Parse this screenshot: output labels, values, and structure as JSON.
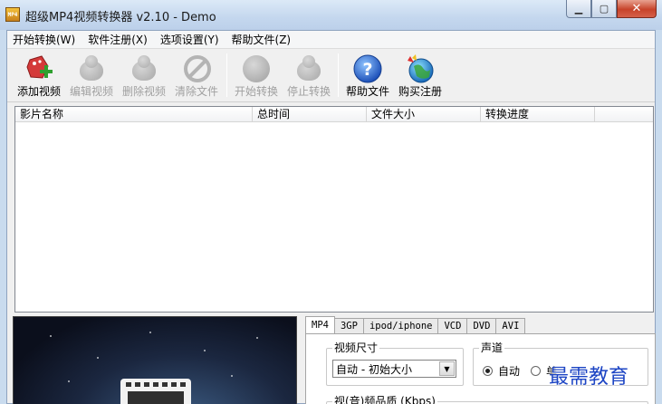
{
  "window": {
    "title": "超级MP4视频转换器 v2.10 - Demo",
    "app_icon_text": "MP4",
    "minimize_glyph": "▁",
    "maximize_glyph": "▢",
    "close_glyph": "✕"
  },
  "menu": {
    "items": [
      "开始转换(W)",
      "软件注册(X)",
      "选项设置(Y)",
      "帮助文件(Z)"
    ]
  },
  "toolbar": {
    "buttons": [
      {
        "label": "添加视频",
        "icon": "add-video-icon",
        "enabled": true
      },
      {
        "label": "编辑视频",
        "icon": "edit-video-icon",
        "enabled": false
      },
      {
        "label": "删除视频",
        "icon": "delete-video-icon",
        "enabled": false
      },
      {
        "label": "清除文件",
        "icon": "clear-files-icon",
        "enabled": false
      },
      {
        "label": "开始转换",
        "icon": "start-convert-icon",
        "enabled": false
      },
      {
        "label": "停止转换",
        "icon": "stop-convert-icon",
        "enabled": false
      },
      {
        "label": "帮助文件",
        "icon": "help-icon",
        "enabled": true
      },
      {
        "label": "购买注册",
        "icon": "buy-register-icon",
        "enabled": true
      }
    ]
  },
  "file_list": {
    "columns": [
      "影片名称",
      "总时间",
      "文件大小",
      "转换进度"
    ],
    "rows": []
  },
  "format_tabs": {
    "tabs": [
      "MP4",
      "3GP",
      "ipod/iphone",
      "VCD",
      "DVD",
      "AVI"
    ],
    "active": "MP4"
  },
  "settings": {
    "video_size_label": "视频尺寸",
    "video_size_value": "自动 - 初始大小",
    "channel_label": "声道",
    "channel_options": [
      "自动",
      "单"
    ],
    "channel_selected": "自动",
    "quality_label": "视(音)频品质 (Kbps)"
  },
  "watermark": "最需教育",
  "colors": {
    "accent": "#1d45c4",
    "close_button": "#c7432a",
    "titlebar": "#c4d7ee"
  }
}
